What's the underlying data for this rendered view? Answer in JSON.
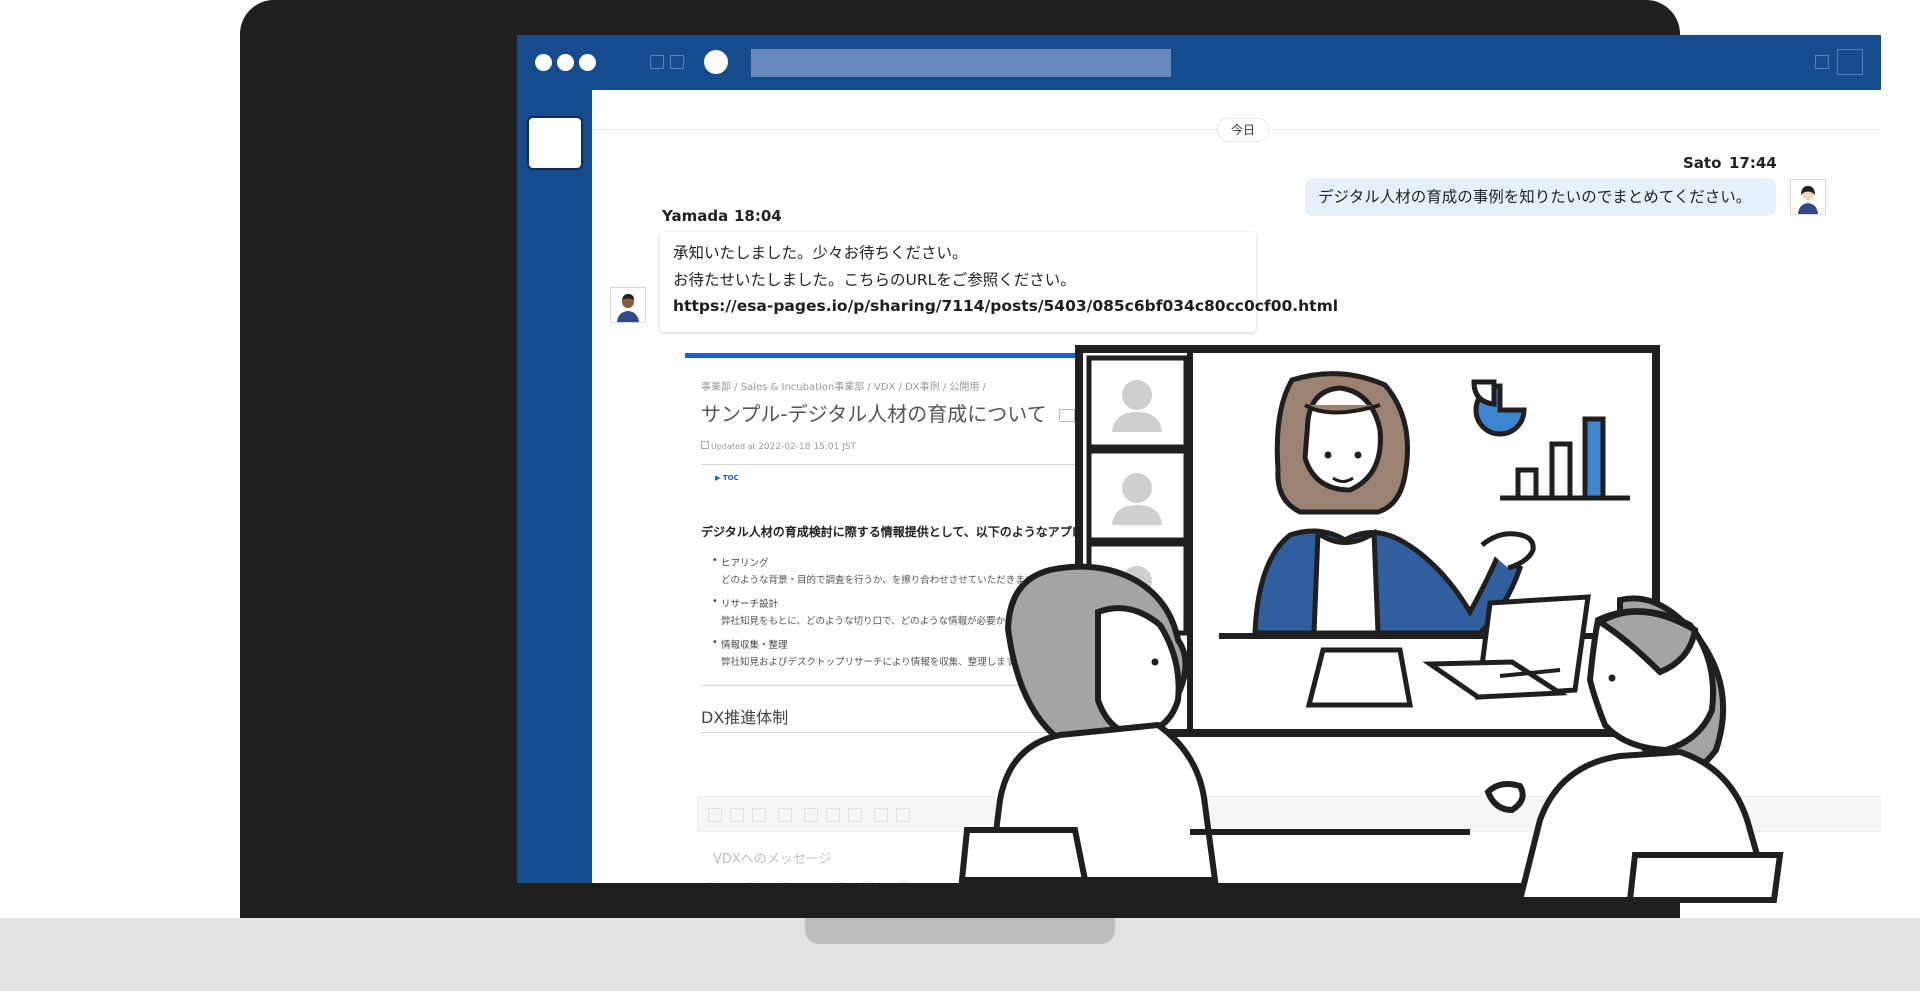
{
  "chat": {
    "date_label": "今日",
    "messages": [
      {
        "sender": "Sato",
        "time": "17:44",
        "text": "デジタル人材の育成の事例を知りたいのでまとめてください。"
      },
      {
        "sender": "Yamada",
        "time": "18:04",
        "lines": [
          "承知いたしました。少々お待ちください。",
          "お待たせいたしました。こちらのURLをご参照ください。",
          "https://esa-pages.io/p/sharing/7114/posts/5403/085c6bf034c80cc0cf00.html"
        ]
      }
    ]
  },
  "preview": {
    "breadcrumb": "事業部 / Sales & Incubation事業部 / VDX / DX事例 / 公開用 /",
    "title": "サンプル-デジタル人材の育成について",
    "updated_label": "Updated at",
    "updated_value": "2022-02-18 15:01 JST",
    "toc_label": "TOC",
    "intro": "デジタル人材の育成検討に際する情報提供として、以下のようなアプローチで、調査を実施",
    "items": [
      {
        "title": "ヒアリング",
        "desc": "どのような背景・目的で調査を行うか、を擦り合わせさせていただきます"
      },
      {
        "title": "リサーチ設計",
        "desc": "弊社知見をもとに、どのような切り口で、どのような情報が必要か、を企業様の背景を鑑み設計します"
      },
      {
        "title": "情報収集・整理",
        "desc": "弊社知見およびデスクトップリサーチにより情報を収集、整理します"
      }
    ],
    "section_heading": "DX推進体制"
  },
  "composer": {
    "placeholder": "VDXへのメッセージ"
  },
  "colors": {
    "brand_blue": "#164b8e",
    "accent_blue": "#1b5fbf",
    "bubble_blue": "#e6f0fb",
    "chart_blue": "#3d86d1"
  }
}
